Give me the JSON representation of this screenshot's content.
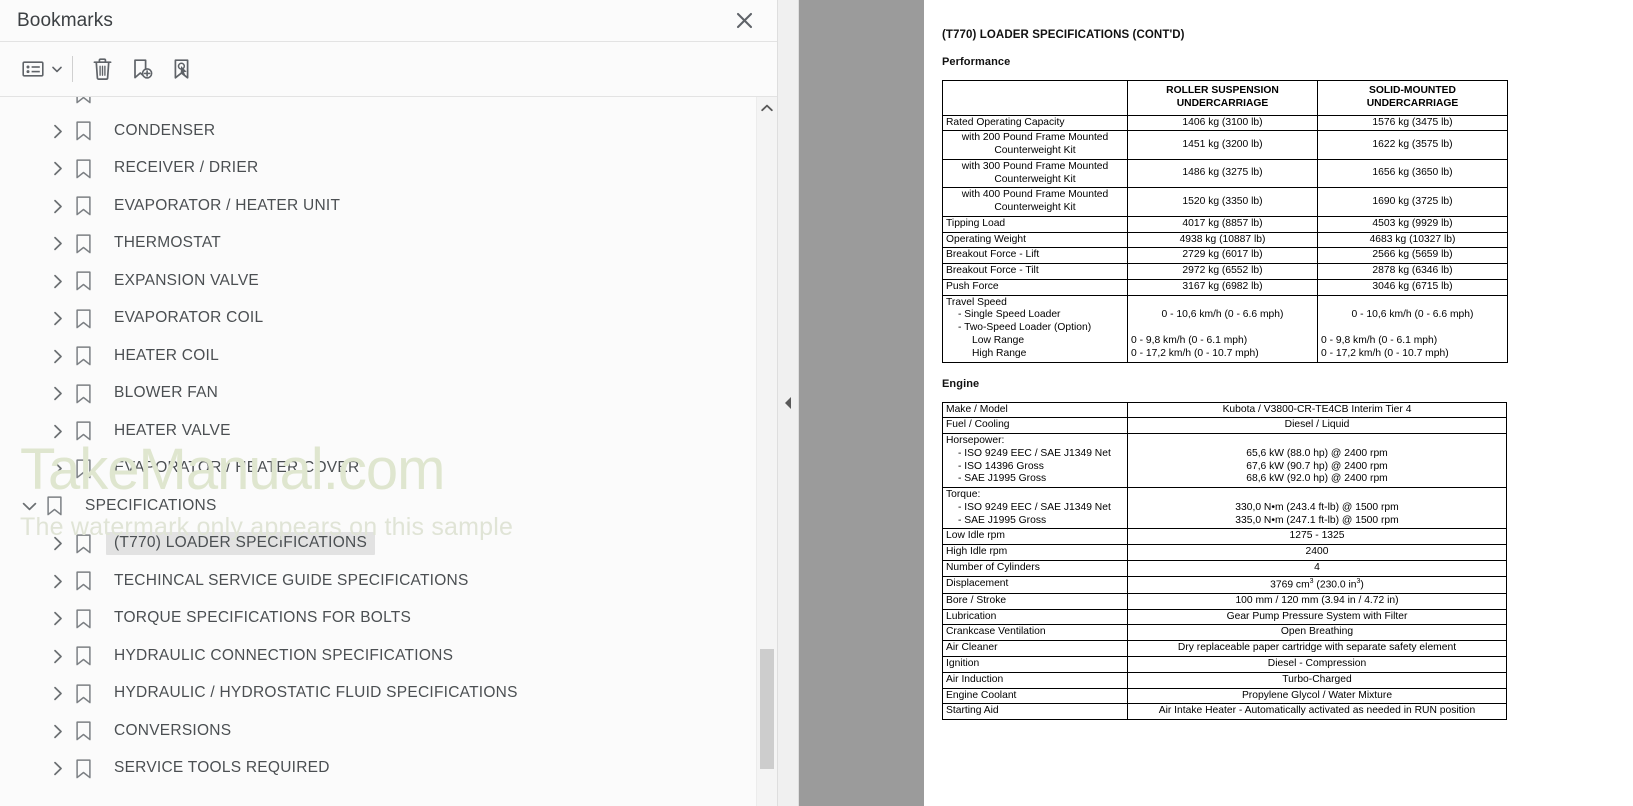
{
  "panel": {
    "title": "Bookmarks",
    "close_icon": "close-icon",
    "toolbar": {
      "list_options_label": "list-options",
      "list_options_caret": "chevron-down-icon",
      "delete_label": "delete-bookmark",
      "add_label": "add-bookmark",
      "edit_label": "edit-bookmark"
    }
  },
  "watermark": {
    "main": "TakeManual.com",
    "sub": "The watermark only appears on this sample"
  },
  "bookmarks": [
    {
      "label": "",
      "level": 1,
      "state": "collapsed",
      "selected": false,
      "partial": true
    },
    {
      "label": "CONDENSER",
      "level": 1,
      "state": "collapsed",
      "selected": false
    },
    {
      "label": "RECEIVER / DRIER",
      "level": 1,
      "state": "collapsed",
      "selected": false
    },
    {
      "label": "EVAPORATOR / HEATER UNIT",
      "level": 1,
      "state": "collapsed",
      "selected": false
    },
    {
      "label": "THERMOSTAT",
      "level": 1,
      "state": "collapsed",
      "selected": false
    },
    {
      "label": "EXPANSION VALVE",
      "level": 1,
      "state": "collapsed",
      "selected": false
    },
    {
      "label": "EVAPORATOR COIL",
      "level": 1,
      "state": "collapsed",
      "selected": false
    },
    {
      "label": "HEATER COIL",
      "level": 1,
      "state": "collapsed",
      "selected": false
    },
    {
      "label": "BLOWER FAN",
      "level": 1,
      "state": "collapsed",
      "selected": false
    },
    {
      "label": "HEATER VALVE",
      "level": 1,
      "state": "collapsed",
      "selected": false
    },
    {
      "label": "EVAPORATOR / HEATER COVER",
      "level": 1,
      "state": "collapsed",
      "selected": false
    },
    {
      "label": "SPECIFICATIONS",
      "level": 0,
      "state": "expanded",
      "selected": false
    },
    {
      "label": "(T770) LOADER SPECIFICATIONS",
      "level": 1,
      "state": "collapsed",
      "selected": true
    },
    {
      "label": "TECHINCAL SERVICE GUIDE SPECIFICATIONS",
      "level": 1,
      "state": "collapsed",
      "selected": false
    },
    {
      "label": "TORQUE SPECIFICATIONS FOR BOLTS",
      "level": 1,
      "state": "collapsed",
      "selected": false
    },
    {
      "label": "HYDRAULIC CONNECTION SPECIFICATIONS",
      "level": 1,
      "state": "collapsed",
      "selected": false
    },
    {
      "label": "HYDRAULIC / HYDROSTATIC FLUID SPECIFICATIONS",
      "level": 1,
      "state": "collapsed",
      "selected": false
    },
    {
      "label": "CONVERSIONS",
      "level": 1,
      "state": "collapsed",
      "selected": false
    },
    {
      "label": "SERVICE TOOLS REQUIRED",
      "level": 1,
      "state": "collapsed",
      "selected": false
    }
  ],
  "document": {
    "heading": "(T770) LOADER SPECIFICATIONS (CONT'D)",
    "performance": {
      "section_title": "Performance",
      "headers": [
        "",
        "ROLLER SUSPENSION UNDERCARRIAGE",
        "SOLID-MOUNTED UNDERCARRIAGE"
      ],
      "header_lines": [
        [
          "",
          ""
        ],
        [
          "ROLLER SUSPENSION",
          "UNDERCARRIAGE"
        ],
        [
          "SOLID-MOUNTED",
          "UNDERCARRIAGE"
        ]
      ],
      "rows": [
        {
          "label": "Rated Operating Capacity",
          "indent": false,
          "roller": "1406 kg (3100 lb)",
          "solid": "1576 kg (3475 lb)"
        },
        {
          "label": "with 200 Pound Frame Mounted Counterweight Kit",
          "indent": true,
          "roller": "1451 kg (3200 lb)",
          "solid": "1622 kg (3575 lb)"
        },
        {
          "label": "with 300 Pound Frame Mounted Counterweight Kit",
          "indent": true,
          "roller": "1486 kg (3275 lb)",
          "solid": "1656 kg (3650 lb)"
        },
        {
          "label": "with 400 Pound Frame Mounted Counterweight Kit",
          "indent": true,
          "roller": "1520 kg (3350 lb)",
          "solid": "1690 kg (3725 lb)"
        },
        {
          "label": "Tipping Load",
          "indent": false,
          "roller": "4017 kg (8857 lb)",
          "solid": "4503 kg (9929 lb)"
        },
        {
          "label": "Operating Weight",
          "indent": false,
          "roller": "4938 kg (10887 lb)",
          "solid": "4683 kg (10327 lb)"
        },
        {
          "label": "Breakout Force - Lift",
          "indent": false,
          "roller": "2729 kg (6017 lb)",
          "solid": "2566 kg (5659 lb)"
        },
        {
          "label": "Breakout Force - Tilt",
          "indent": false,
          "roller": "2972 kg (6552 lb)",
          "solid": "2878 kg (6346 lb)"
        },
        {
          "label": "Push Force",
          "indent": false,
          "roller": "3167 kg (6982 lb)",
          "solid": "3046 kg (6715 lb)"
        }
      ],
      "travel_speed": {
        "label_lines": [
          "Travel Speed",
          "- Single Speed Loader",
          "- Two-Speed Loader (Option)",
          "Low Range",
          "High Range"
        ],
        "roller_lines": [
          "",
          "0 - 10,6 km/h (0 - 6.6 mph)",
          "",
          "0 - 9,8 km/h (0 - 6.1 mph)",
          "0 - 17,2 km/h (0 - 10.7 mph)"
        ],
        "solid_lines": [
          "",
          "0 - 10,6 km/h (0 - 6.6 mph)",
          "",
          "0 - 9,8 km/h (0 - 6.1 mph)",
          "0 - 17,2 km/h (0 - 10.7 mph)"
        ]
      }
    },
    "engine": {
      "section_title": "Engine",
      "rows": [
        {
          "label": "Make / Model",
          "value": "Kubota / V3800-CR-TE4CB Interim Tier 4"
        },
        {
          "label": "Fuel / Cooling",
          "value": "Diesel / Liquid"
        },
        {
          "label_lines": [
            "Horsepower:",
            "- ISO 9249 EEC / SAE J1349 Net",
            "- ISO 14396 Gross",
            "- SAE J1995 Gross"
          ],
          "value_lines": [
            "",
            "65,6 kW (88.0 hp) @ 2400 rpm",
            "67,6 kW (90.7 hp) @ 2400 rpm",
            "68,6 kW (92.0 hp) @ 2400 rpm"
          ]
        },
        {
          "label_lines": [
            "Torque:",
            "- ISO 9249 EEC / SAE J1349 Net",
            "- SAE J1995 Gross"
          ],
          "value_lines": [
            "",
            "330,0 N•m (243.4 ft-lb) @ 1500 rpm",
            "335,0 N•m (247.1 ft-lb) @ 1500 rpm"
          ]
        },
        {
          "label": "Low Idle rpm",
          "value": "1275 - 1325"
        },
        {
          "label": "High Idle rpm",
          "value": "2400"
        },
        {
          "label": "Number of Cylinders",
          "value": "4"
        },
        {
          "label": "Displacement",
          "value": "3769 cm3 (230.0 in3)",
          "html_value": "3769 cm<sup>3</sup> (230.0 in<sup>3</sup>)"
        },
        {
          "label": "Bore / Stroke",
          "value": "100 mm / 120 mm (3.94 in / 4.72 in)"
        },
        {
          "label": "Lubrication",
          "value": "Gear Pump Pressure System with Filter"
        },
        {
          "label": "Crankcase Ventilation",
          "value": "Open Breathing"
        },
        {
          "label": "Air Cleaner",
          "value": "Dry replaceable paper cartridge with separate safety element"
        },
        {
          "label": "Ignition",
          "value": "Diesel - Compression"
        },
        {
          "label": "Air Induction",
          "value": "Turbo-Charged"
        },
        {
          "label": "Engine Coolant",
          "value": "Propylene Glycol / Water Mixture"
        },
        {
          "label": "Starting Aid",
          "value": "Air Intake Heater - Automatically activated as needed in RUN position"
        }
      ]
    }
  },
  "colors": {
    "panel_bg": "#fbfbfb",
    "selection": "#e2e2e2",
    "gutter": "#9b9b9b",
    "watermark": "#dfe6cf",
    "text": "#4b4f52"
  }
}
